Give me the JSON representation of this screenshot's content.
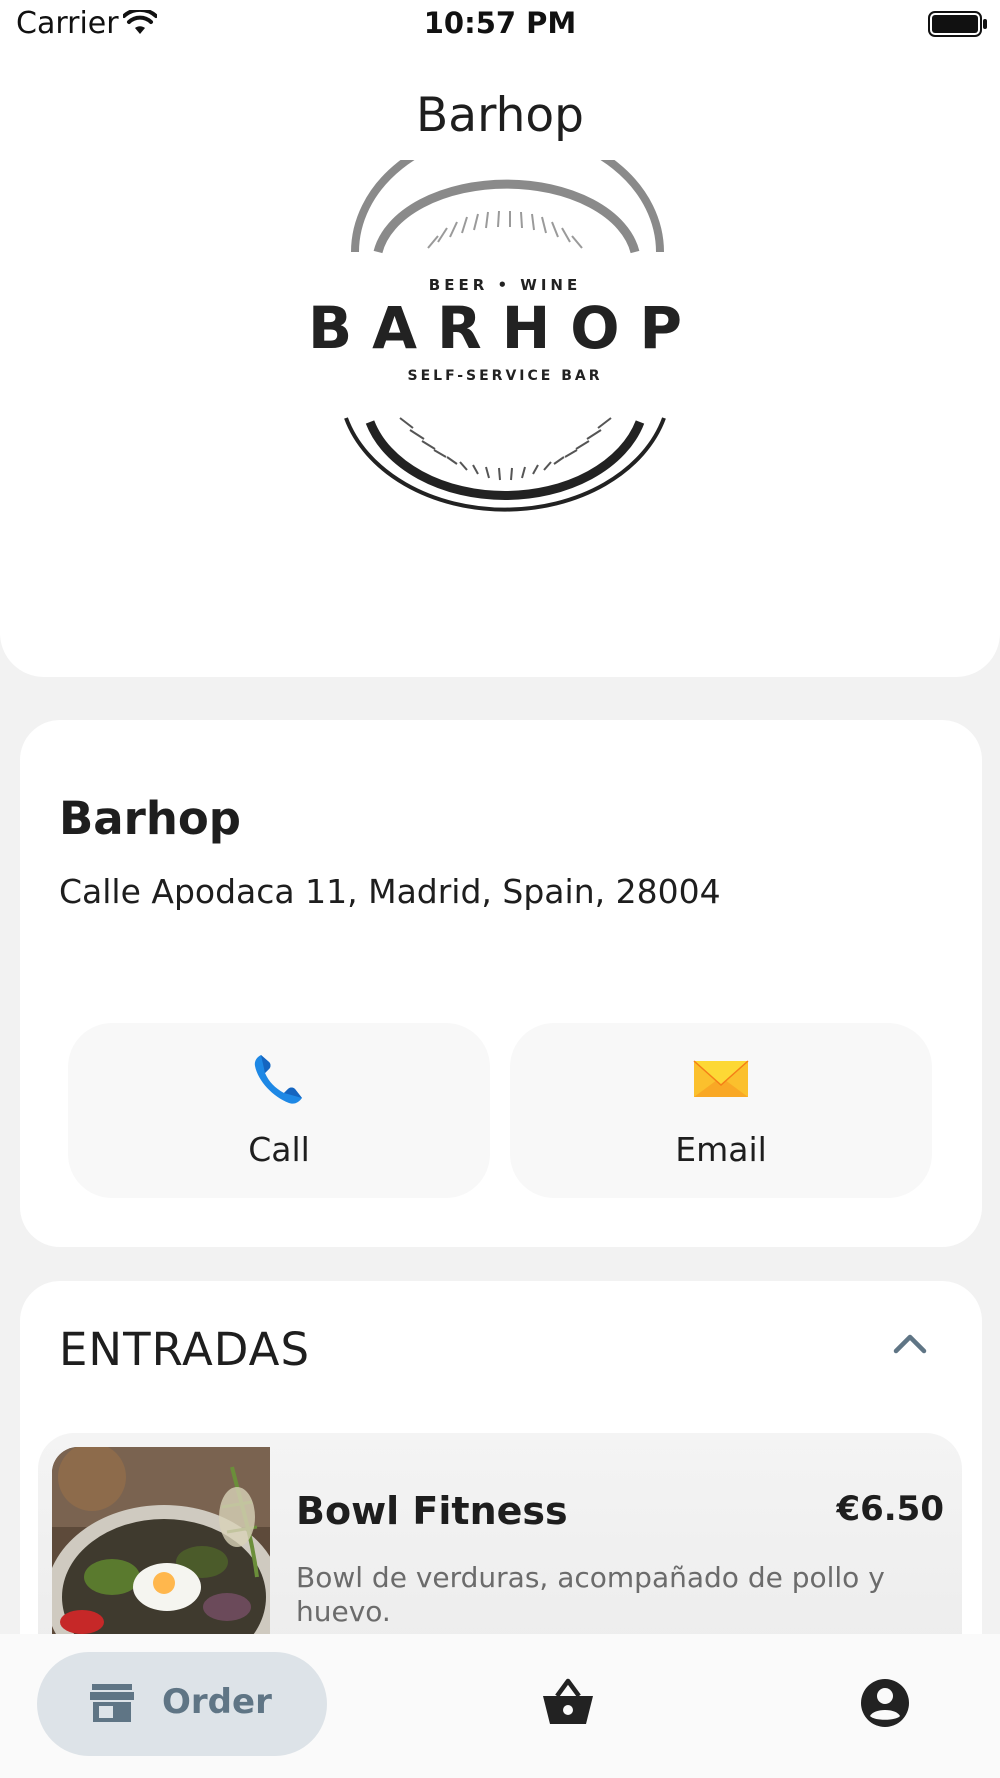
{
  "status_bar": {
    "carrier": "Carrier",
    "time": "10:57 PM"
  },
  "header": {
    "title": "Barhop",
    "logo": {
      "tagline_top": "BEER • WINE",
      "name": "BARHOP",
      "tagline_bottom": "SELF-SERVICE BAR"
    }
  },
  "restaurant": {
    "name": "Barhop",
    "address": "Calle Apodaca 11, Madrid, Spain, 28004",
    "actions": [
      {
        "label": "Call",
        "icon": "phone-icon"
      },
      {
        "label": "Email",
        "icon": "envelope-icon"
      }
    ]
  },
  "menu": {
    "section_title": "ENTRADAS",
    "items": [
      {
        "name": "Bowl Fitness",
        "price": "€6.50",
        "description": "Bowl de verduras, acompañado de pollo y huevo."
      }
    ]
  },
  "bottom_nav": {
    "order_label": "Order",
    "items": [
      "storefront-icon",
      "basket-icon",
      "account-circle-icon"
    ]
  },
  "colors": {
    "background": "#f2f2f2",
    "card": "#ffffff",
    "nav_active_pill": "#dde3e8",
    "nav_active_text": "#5f7585",
    "phone_blue": "#1e88e5",
    "envelope_yellow": "#fbc02d"
  }
}
